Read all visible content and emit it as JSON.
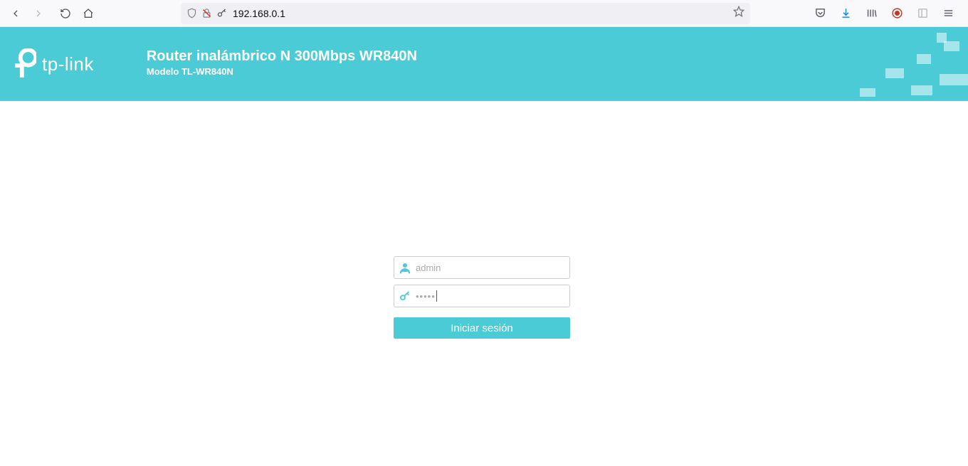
{
  "browser": {
    "url": "192.168.0.1"
  },
  "header": {
    "brand": "tp-link",
    "title": "Router inalámbrico N 300Mbps WR840N",
    "subtitle": "Modelo TL-WR840N"
  },
  "login": {
    "username_placeholder": "admin",
    "password_value": "•••••",
    "button_label": "Iniciar sesión"
  }
}
